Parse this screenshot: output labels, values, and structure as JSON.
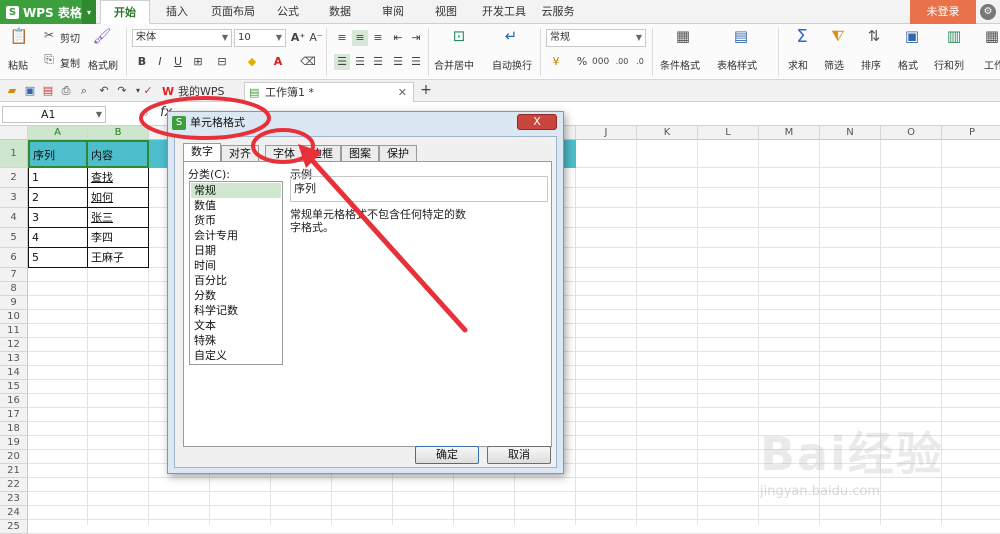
{
  "app": {
    "name": "WPS 表格",
    "logo": "S"
  },
  "menu": {
    "tabs": [
      "开始",
      "插入",
      "页面布局",
      "公式",
      "数据",
      "审阅",
      "视图",
      "开发工具",
      "云服务"
    ],
    "login": "未登录",
    "active_tab": "开始"
  },
  "ribbon": {
    "paste": "粘贴",
    "cut": "剪切",
    "copy": "复制",
    "format_painter": "格式刷",
    "font_name": "宋体",
    "font_size": "10",
    "bold": "B",
    "italic": "I",
    "underline": "U",
    "number_format": "常规",
    "percent": "%",
    "merge_center": "合并居中",
    "wrap_text": "自动换行",
    "cond_format": "条件格式",
    "table_style": "表格样式",
    "sum": "求和",
    "filter": "筛选",
    "sort": "排序",
    "format": "格式",
    "rows_cols": "行和列",
    "worksheet": "工作"
  },
  "doc_tabs": [
    {
      "label": "我的WPS"
    },
    {
      "label": "工作簿1 *"
    }
  ],
  "formula_bar": {
    "name_box": "A1",
    "fx": "fx"
  },
  "grid": {
    "columns": [
      "A",
      "B",
      "C",
      "D",
      "E",
      "F",
      "G",
      "H",
      "I",
      "J",
      "K",
      "L",
      "M",
      "N",
      "O",
      "P"
    ],
    "rows": [
      "1",
      "2",
      "3",
      "4",
      "5",
      "6",
      "7",
      "8",
      "9",
      "10",
      "11",
      "12",
      "13",
      "14",
      "15",
      "16",
      "17",
      "18",
      "19",
      "20",
      "21",
      "22",
      "23",
      "24",
      "25"
    ],
    "header": {
      "a": "序列",
      "b": "内容"
    },
    "data": [
      {
        "a": "1",
        "b": "查找"
      },
      {
        "a": "2",
        "b": "如何"
      },
      {
        "a": "3",
        "b": "张三"
      },
      {
        "a": "4",
        "b": "李四"
      },
      {
        "a": "5",
        "b": "王麻子"
      }
    ]
  },
  "dialog": {
    "title": "单元格格式",
    "close": "X",
    "tabs": [
      "数字",
      "对齐",
      "字体",
      "边框",
      "图案",
      "保护"
    ],
    "category_label": "分类(C):",
    "categories": [
      "常规",
      "数值",
      "货币",
      "会计专用",
      "日期",
      "时间",
      "百分比",
      "分数",
      "科学记数",
      "文本",
      "特殊",
      "自定义"
    ],
    "sample_label": "示例",
    "sample_value": "序列",
    "description": "常规单元格格式不包含任何特定的数字格式。",
    "ok": "确定",
    "cancel": "取消"
  },
  "watermark": {
    "brand": "Bai经验",
    "url": "jingyan.baidu.com"
  },
  "colors": {
    "accent_green": "#3c9e3c",
    "login_orange": "#e9724a",
    "header_fill": "#3ab7c7",
    "annotation_red": "#e8303a"
  }
}
